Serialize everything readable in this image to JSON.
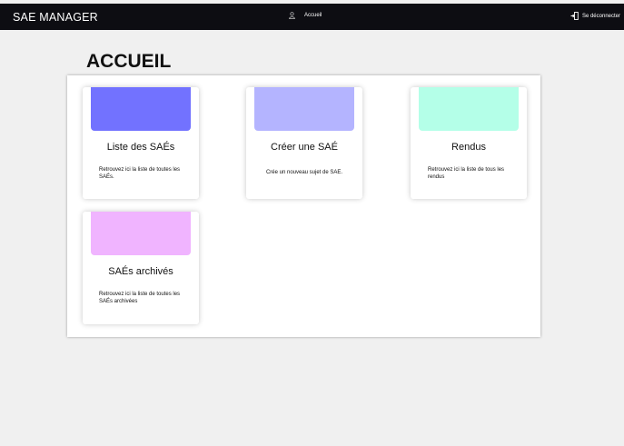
{
  "header": {
    "brand": "SAE MANAGER",
    "home_label": "Accueil",
    "logout_label": "Se déconnecter"
  },
  "page": {
    "title": "ACCUEIL"
  },
  "cards": [
    {
      "title": "Liste des SAÉs",
      "description": "Retrouvez ici la liste de toutes les SAÉs.",
      "color": "#7272ff"
    },
    {
      "title": "Créer une SAÉ",
      "description": "Crée un nouveau sujet de SAE.",
      "color": "#b4b4ff"
    },
    {
      "title": "Rendus",
      "description": "Retrouvez ici la liste de tous les rendus",
      "color": "#b4ffe8"
    },
    {
      "title": "SAÉs archivés",
      "description": "Retrouvez ici la liste de toutes les SAÉs archivées",
      "color": "#f0b4ff"
    }
  ]
}
